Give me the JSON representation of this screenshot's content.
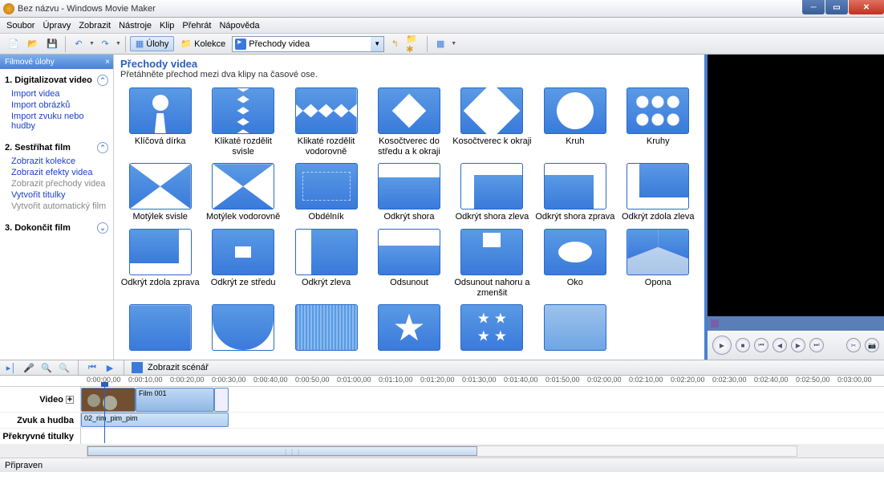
{
  "window": {
    "title": "Bez názvu - Windows Movie Maker"
  },
  "menu": [
    "Soubor",
    "Úpravy",
    "Zobrazit",
    "Nástroje",
    "Klip",
    "Přehrát",
    "Nápověda"
  ],
  "toolbar": {
    "tasks_label": "Úlohy",
    "collections_label": "Kolekce",
    "combo_value": "Přechody videa"
  },
  "sidebar": {
    "header": "Filmové úlohy",
    "sections": [
      {
        "title": "1. Digitalizovat video",
        "links": [
          {
            "text": "Import videa",
            "enabled": true
          },
          {
            "text": "Import obrázků",
            "enabled": true
          },
          {
            "text": "Import zvuku nebo hudby",
            "enabled": true
          }
        ]
      },
      {
        "title": "2. Sestříhat film",
        "links": [
          {
            "text": "Zobrazit kolekce",
            "enabled": true
          },
          {
            "text": "Zobrazit efekty videa",
            "enabled": true
          },
          {
            "text": "Zobrazit přechody videa",
            "enabled": false
          },
          {
            "text": "Vytvořit titulky",
            "enabled": true
          },
          {
            "text": "Vytvořit automatický film",
            "enabled": false
          }
        ]
      },
      {
        "title": "3. Dokončit film",
        "links": []
      }
    ]
  },
  "content": {
    "title": "Přechody videa",
    "subtitle": "Přetáhněte přechod mezi dva klipy na časové ose.",
    "transitions": [
      {
        "label": "Klíčová dírka",
        "shape": "t-keyhole"
      },
      {
        "label": "Klikaté rozdělit svisle",
        "shape": "t-zigzag-v"
      },
      {
        "label": "Klikaté rozdělit vodorovně",
        "shape": "t-zigzag-h"
      },
      {
        "label": "Kosočtverec do středu a k okraji",
        "shape": "t-diamond-c"
      },
      {
        "label": "Kosočtverec k okraji",
        "shape": "t-diamond-e"
      },
      {
        "label": "Kruh",
        "shape": "t-circle"
      },
      {
        "label": "Kruhy",
        "shape": "t-circles"
      },
      {
        "label": "Motýlek svisle",
        "shape": "t-bowtie-vr"
      },
      {
        "label": "Motýlek vodorovně",
        "shape": "t-bowtie-h"
      },
      {
        "label": "Obdélník",
        "shape": "t-rect"
      },
      {
        "label": "Odkrýt shora",
        "shape": "t-reveal-t"
      },
      {
        "label": "Odkrýt shora zleva",
        "shape": "t-reveal-tl"
      },
      {
        "label": "Odkrýt shora zprava",
        "shape": "t-reveal-tr"
      },
      {
        "label": "Odkrýt zdola zleva",
        "shape": "t-reveal-bl"
      },
      {
        "label": "Odkrýt zdola zprava",
        "shape": "t-reveal-br"
      },
      {
        "label": "Odkrýt ze středu",
        "shape": "t-reveal-c"
      },
      {
        "label": "Odkrýt zleva",
        "shape": "t-reveal-l"
      },
      {
        "label": "Odsunout",
        "shape": "t-slide"
      },
      {
        "label": "Odsunout nahoru a zmenšit",
        "shape": "t-slide2"
      },
      {
        "label": "Oko",
        "shape": "t-eye"
      },
      {
        "label": "Opona",
        "shape": "t-curtain"
      },
      {
        "label": "",
        "shape": "t-fan"
      },
      {
        "label": "",
        "shape": "t-arcs"
      },
      {
        "label": "",
        "shape": "t-blinds"
      },
      {
        "label": "",
        "shape": "t-star"
      },
      {
        "label": "",
        "shape": "t-stars"
      },
      {
        "label": "",
        "shape": "t-fade"
      }
    ]
  },
  "timeline": {
    "storyboard_label": "Zobrazit scénář",
    "ruler": [
      "0:00:00,00",
      "0:00:10,00",
      "0:00:20,00",
      "0:00:30,00",
      "0:00:40,00",
      "0:00:50,00",
      "0:01:00,00",
      "0:01:10,00",
      "0:01:20,00",
      "0:01:30,00",
      "0:01:40,00",
      "0:01:50,00",
      "0:02:00,00",
      "0:02:10,00",
      "0:02:20,00",
      "0:02:30,00",
      "0:02:40,00",
      "0:02:50,00",
      "0:03:00,00"
    ],
    "tracks": {
      "video": "Video",
      "audio": "Zvuk a hudba",
      "titles": "Překryvné titulky"
    },
    "clips": {
      "video_clip_label": "Film 001",
      "audio_clip_label": "02_rim_pim_pim"
    }
  },
  "status": "Připraven"
}
